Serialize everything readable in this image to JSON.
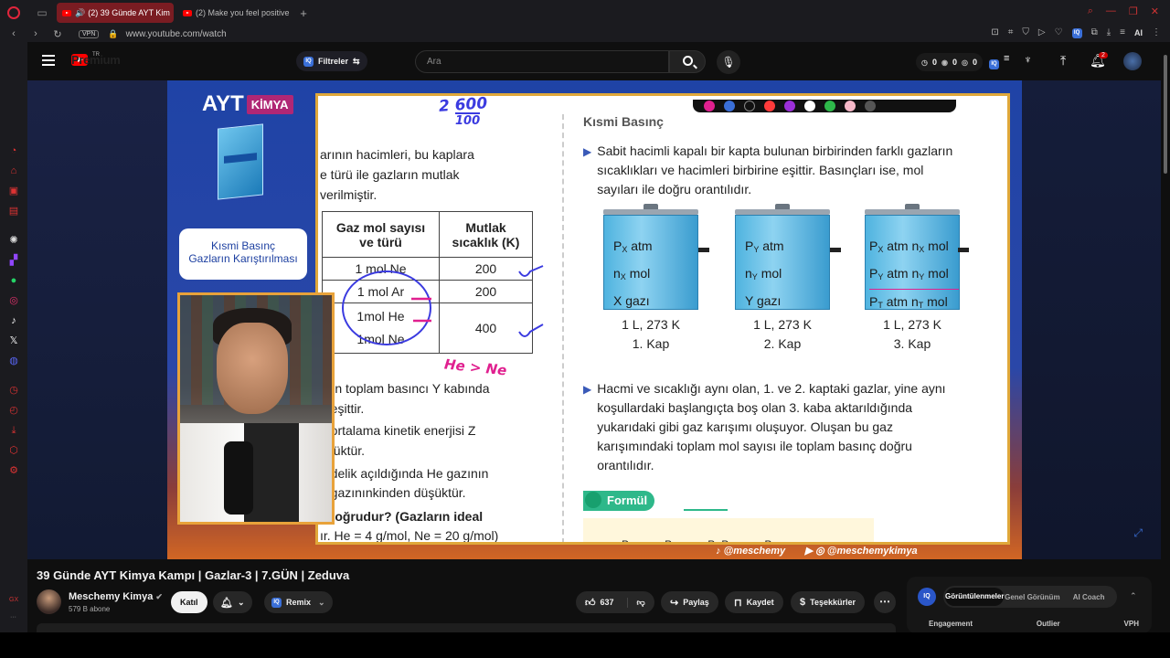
{
  "browser": {
    "tabs": [
      {
        "label": "(2) 39 Günde AYT Kim",
        "active": true
      },
      {
        "label": "(2) Make you feel positive",
        "active": false
      }
    ],
    "vpn": "VPN",
    "url": "www.youtube.com/watch",
    "ai_label": "AI"
  },
  "header": {
    "logo_text": "Premium",
    "region": "TR",
    "filter_label": "Filtreler",
    "search_placeholder": "Ara",
    "stats": [
      "0",
      "0",
      "0"
    ],
    "notif_count": "2"
  },
  "slide": {
    "brand": "AYT",
    "brand_tag": "KİMYA",
    "topic_line1": "Kısmi Basınç",
    "topic_line2": "Gazların Karıştırılması",
    "left_text": [
      "arının hacimleri, bu kaplara",
      "e türü ile gazların mutlak",
      "verilmiştir."
    ],
    "table_headers": [
      "Gaz mol sayısı\nve türü",
      "Mutlak\nsıcaklık (K)"
    ],
    "table_rows": [
      {
        "gas": "1 mol Ne",
        "temp": "200"
      },
      {
        "gas": "1 mol Ar",
        "temp": "200"
      },
      {
        "gas": "1mol He\n1mol Ne",
        "temp": "400"
      }
    ],
    "left_lower": [
      "arın toplam basıncı Y kabında",
      "e eşittir.",
      "n ortalama kinetik enerjisi Z",
      "üşüktür.",
      "ir delik açıldığında He gazının",
      "e gazınınkinden düşüktür.",
      "i doğrudur? (Gazların ideal",
      "ır. He = 4 g/mol, Ne = 20 g/mol)"
    ],
    "ink_top": "2 600",
    "ink_top2": "100",
    "ink_bottom": "He > Ne",
    "section_title": "Kısmi Basınç",
    "para1": "Sabit hacimli kapalı bir kapta bulunan birbirinden farklı gazların sıcaklıkları ve hacimleri birbirine eşittir. Basınçları ise, mol sayıları ile doğru orantılıdır.",
    "para2": "Hacmi ve sıcaklığı aynı olan, 1. ve 2. kaptaki gazlar, yine aynı koşullardaki başlangıçta boş olan 3. kaba aktarıldığında yukarıdaki gibi gaz karışımı oluşuyor. Oluşan bu gaz karışımındaki toplam mol sayısı ile toplam basınç doğru orantılıdır.",
    "containers": [
      {
        "lines": [
          "P_X atm",
          "n_X mol",
          "X gazı"
        ],
        "cond": "1 L, 273 K",
        "name": "1. Kap"
      },
      {
        "lines": [
          "P_Y atm",
          "n_Y mol",
          "Y gazı"
        ],
        "cond": "1 L, 273 K",
        "name": "2. Kap"
      },
      {
        "lines": [
          "P_X atm n_X mol",
          "P_Y atm n_Y mol",
          "P_T atm n_T mol"
        ],
        "cond": "1 L, 273 K",
        "name": "3. Kap"
      }
    ],
    "formul_label": "Formül",
    "formula_preview": "P P P+P P",
    "watermark_tiktok": "@meschemy",
    "watermark_yt": "@meschemykimya"
  },
  "video": {
    "title": "39 Günde AYT Kimya Kampı | Gazlar-3 | 7.GÜN | Zeduva",
    "channel": "Meschemy Kimya",
    "subs": "579 B abone",
    "join": "Katıl",
    "remix": "Remix",
    "likes": "637",
    "share": "Paylaş",
    "save": "Kaydet",
    "thanks": "Teşekkürler"
  },
  "iq_panel": {
    "tabs": [
      "Görüntülenmeler",
      "Genel Görünüm",
      "AI Coach"
    ],
    "columns": [
      "Engagement",
      "Outlier",
      "VPH"
    ]
  },
  "colors": {
    "accent_red": "#ff0000",
    "slide_blue": "#1f43a6",
    "frame_orange": "#e0a83a"
  }
}
